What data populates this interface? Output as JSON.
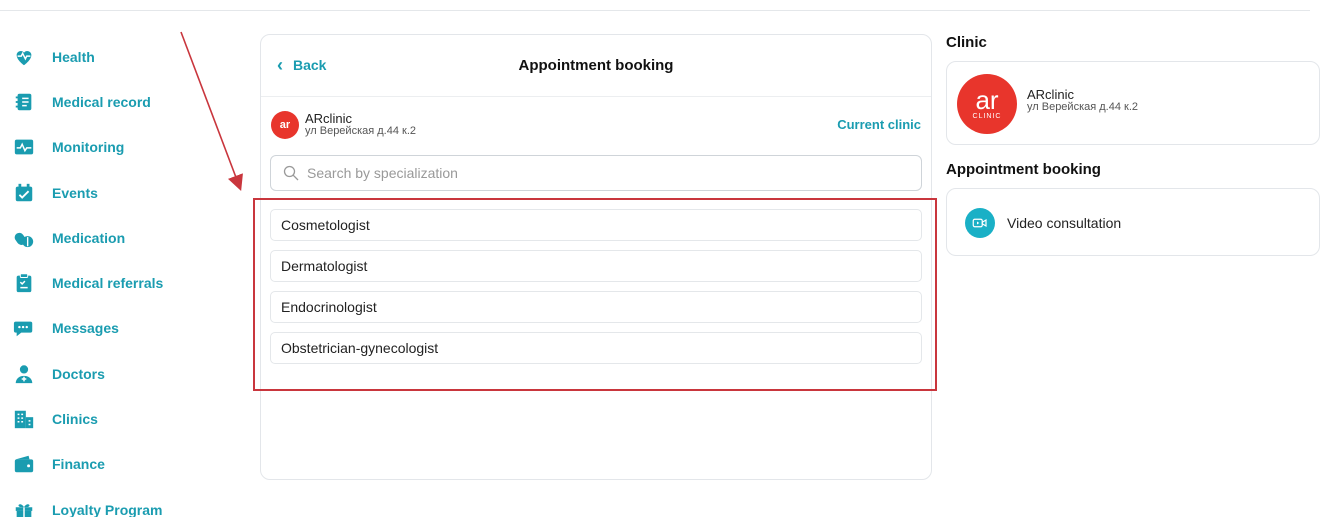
{
  "sidebar": {
    "items": [
      {
        "label": "Health",
        "icon": "heart-pulse-icon"
      },
      {
        "label": "Medical record",
        "icon": "notebook-icon"
      },
      {
        "label": "Monitoring",
        "icon": "monitor-pulse-icon"
      },
      {
        "label": "Events",
        "icon": "calendar-check-icon"
      },
      {
        "label": "Medication",
        "icon": "pills-icon"
      },
      {
        "label": "Medical referrals",
        "icon": "clipboard-icon"
      },
      {
        "label": "Messages",
        "icon": "chat-icon"
      },
      {
        "label": "Doctors",
        "icon": "doctor-icon"
      },
      {
        "label": "Clinics",
        "icon": "building-icon"
      },
      {
        "label": "Finance",
        "icon": "wallet-icon"
      },
      {
        "label": "Loyalty Program",
        "icon": "gift-icon"
      }
    ],
    "accent": "#1a9cb0"
  },
  "main": {
    "back_label": "Back",
    "title": "Appointment booking",
    "clinic": {
      "logo_text": "ar",
      "name": "ARclinic",
      "address": "ул Верейская д.44 к.2",
      "current_label": "Current clinic"
    },
    "search": {
      "placeholder": "Search by specialization",
      "value": ""
    },
    "specializations": [
      "Cosmetologist",
      "Dermatologist",
      "Endocrinologist",
      "Obstetrician-gynecologist"
    ]
  },
  "right": {
    "clinic_heading": "Clinic",
    "clinic": {
      "logo_mark": "ar",
      "logo_sub": "CLINIC",
      "name": "ARclinic",
      "address": "ул Верейская д.44 к.2"
    },
    "booking_heading": "Appointment booking",
    "video_label": "Video consultation"
  },
  "colors": {
    "brand": "#e8352c",
    "annotation": "#c9363d"
  }
}
